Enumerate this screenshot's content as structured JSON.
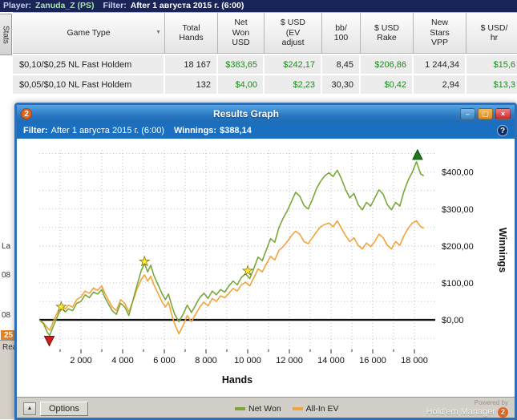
{
  "top_bar": {
    "player_label": "Player:",
    "player_name": "Zanuda_Z (PS)",
    "filter_label": "Filter:",
    "filter_value": "After 1 августа 2015 г. (6:00)"
  },
  "sidebar": {
    "stats_tab": "Stats",
    "fragment_la": "La",
    "fragment_08a": "08",
    "fragment_08b": "08",
    "fragment_25": "25",
    "fragment_read": "Read"
  },
  "table": {
    "sort_arrow": "▼",
    "columns": [
      "Game Type",
      "Total\nHands",
      "Net\nWon\nUSD",
      "$ USD\n(EV\nadjust",
      "bb/\n100",
      "$ USD\nRake",
      "New\nStars\nVPP",
      "$ USD/\nhr"
    ],
    "rows": [
      {
        "game_type": "$0,10/$0,25 NL Fast Holdem",
        "total_hands": "18 167",
        "net_won": "$383,65",
        "ev_adjust": "$242,17",
        "bb100": "8,45",
        "rake": "$206,86",
        "vpp": "1 244,34",
        "usd_hr": "$15,6"
      },
      {
        "game_type": "$0,05/$0,10 NL Fast Holdem",
        "total_hands": "132",
        "net_won": "$4,00",
        "ev_adjust": "$2,23",
        "bb100": "30,30",
        "rake": "$0,42",
        "vpp": "2,94",
        "usd_hr": "$13,3"
      }
    ]
  },
  "window": {
    "logo": "2",
    "title": "Results Graph",
    "min": "–",
    "max": "▢",
    "close": "×",
    "filter_label": "Filter:",
    "filter_value": "After 1 августа 2015 г. (6:00)",
    "winnings_label": "Winnings:",
    "winnings_value": "$388,14",
    "help": "?",
    "collapse": "▲",
    "options": "Options",
    "legend": [
      {
        "label": "Net Won",
        "color": "#78A83A"
      },
      {
        "label": "All-In EV",
        "color": "#F2A33C"
      }
    ],
    "powered_by": "Powered by",
    "brand": "Hold'em Manager",
    "badge": "2"
  },
  "chart_data": {
    "type": "line",
    "xlabel": "Hands",
    "ylabel": "Winnings",
    "xlim": [
      0,
      19000
    ],
    "ylim": [
      -80,
      460
    ],
    "grid": {
      "x_step": 1000,
      "y_step": 50,
      "y_start": -50,
      "y_end": 450
    },
    "x_ticks": [
      {
        "v": 2000,
        "label": "2 000"
      },
      {
        "v": 4000,
        "label": "4 000"
      },
      {
        "v": 6000,
        "label": "6 000"
      },
      {
        "v": 8000,
        "label": "8 000"
      },
      {
        "v": 10000,
        "label": "10 000"
      },
      {
        "v": 12000,
        "label": "12 000"
      },
      {
        "v": 14000,
        "label": "14 000"
      },
      {
        "v": 16000,
        "label": "16 000"
      },
      {
        "v": 18000,
        "label": "18 000"
      }
    ],
    "y_ticks": [
      {
        "v": 0,
        "label": "$0,00"
      },
      {
        "v": 100,
        "label": "$100,00"
      },
      {
        "v": 200,
        "label": "$200,00"
      },
      {
        "v": 300,
        "label": "$300,00"
      },
      {
        "v": 400,
        "label": "$400,00"
      }
    ],
    "series": [
      {
        "name": "All-In EV",
        "color": "#F2A33C",
        "points": [
          [
            0,
            0
          ],
          [
            200,
            -8
          ],
          [
            400,
            -22
          ],
          [
            500,
            -28
          ],
          [
            650,
            -8
          ],
          [
            800,
            12
          ],
          [
            950,
            28
          ],
          [
            1100,
            38
          ],
          [
            1250,
            30
          ],
          [
            1400,
            40
          ],
          [
            1600,
            35
          ],
          [
            1800,
            55
          ],
          [
            2000,
            62
          ],
          [
            2200,
            78
          ],
          [
            2400,
            72
          ],
          [
            2600,
            86
          ],
          [
            2800,
            80
          ],
          [
            3000,
            92
          ],
          [
            3150,
            72
          ],
          [
            3300,
            55
          ],
          [
            3500,
            35
          ],
          [
            3700,
            25
          ],
          [
            3900,
            55
          ],
          [
            4100,
            45
          ],
          [
            4300,
            22
          ],
          [
            4500,
            52
          ],
          [
            4700,
            85
          ],
          [
            4900,
            110
          ],
          [
            5050,
            122
          ],
          [
            5200,
            105
          ],
          [
            5350,
            118
          ],
          [
            5500,
            95
          ],
          [
            5700,
            72
          ],
          [
            5900,
            48
          ],
          [
            6050,
            35
          ],
          [
            6200,
            48
          ],
          [
            6350,
            15
          ],
          [
            6500,
            -12
          ],
          [
            6700,
            -38
          ],
          [
            6900,
            -15
          ],
          [
            7100,
            12
          ],
          [
            7300,
            -5
          ],
          [
            7500,
            15
          ],
          [
            7700,
            35
          ],
          [
            7900,
            48
          ],
          [
            8100,
            38
          ],
          [
            8300,
            58
          ],
          [
            8500,
            50
          ],
          [
            8700,
            65
          ],
          [
            8900,
            60
          ],
          [
            9100,
            72
          ],
          [
            9300,
            85
          ],
          [
            9500,
            78
          ],
          [
            9700,
            95
          ],
          [
            9900,
            102
          ],
          [
            10100,
            92
          ],
          [
            10300,
            115
          ],
          [
            10500,
            138
          ],
          [
            10700,
            130
          ],
          [
            10900,
            152
          ],
          [
            11100,
            172
          ],
          [
            11300,
            162
          ],
          [
            11500,
            188
          ],
          [
            11700,
            198
          ],
          [
            11900,
            212
          ],
          [
            12100,
            228
          ],
          [
            12300,
            240
          ],
          [
            12500,
            232
          ],
          [
            12700,
            212
          ],
          [
            12900,
            206
          ],
          [
            13100,
            222
          ],
          [
            13300,
            238
          ],
          [
            13500,
            252
          ],
          [
            13700,
            258
          ],
          [
            13900,
            262
          ],
          [
            14100,
            252
          ],
          [
            14300,
            268
          ],
          [
            14500,
            248
          ],
          [
            14700,
            228
          ],
          [
            14900,
            212
          ],
          [
            15100,
            222
          ],
          [
            15300,
            202
          ],
          [
            15500,
            192
          ],
          [
            15700,
            208
          ],
          [
            15900,
            198
          ],
          [
            16100,
            212
          ],
          [
            16300,
            232
          ],
          [
            16500,
            222
          ],
          [
            16700,
            202
          ],
          [
            16900,
            192
          ],
          [
            17100,
            212
          ],
          [
            17300,
            202
          ],
          [
            17500,
            228
          ],
          [
            17700,
            248
          ],
          [
            17900,
            262
          ],
          [
            18100,
            268
          ],
          [
            18300,
            252
          ],
          [
            18450,
            248
          ]
        ]
      },
      {
        "name": "Net Won",
        "color": "#78A83A",
        "points": [
          [
            0,
            0
          ],
          [
            200,
            -10
          ],
          [
            400,
            -35
          ],
          [
            500,
            -42
          ],
          [
            650,
            -20
          ],
          [
            800,
            0
          ],
          [
            950,
            20
          ],
          [
            1100,
            32
          ],
          [
            1250,
            22
          ],
          [
            1400,
            30
          ],
          [
            1600,
            25
          ],
          [
            1800,
            45
          ],
          [
            2000,
            50
          ],
          [
            2200,
            68
          ],
          [
            2400,
            60
          ],
          [
            2600,
            75
          ],
          [
            2800,
            70
          ],
          [
            3000,
            82
          ],
          [
            3150,
            60
          ],
          [
            3300,
            45
          ],
          [
            3500,
            25
          ],
          [
            3700,
            15
          ],
          [
            3900,
            45
          ],
          [
            4100,
            35
          ],
          [
            4300,
            12
          ],
          [
            4500,
            55
          ],
          [
            4700,
            95
          ],
          [
            4900,
            135
          ],
          [
            5050,
            152
          ],
          [
            5200,
            130
          ],
          [
            5350,
            148
          ],
          [
            5500,
            120
          ],
          [
            5700,
            95
          ],
          [
            5900,
            70
          ],
          [
            6050,
            55
          ],
          [
            6200,
            70
          ],
          [
            6350,
            40
          ],
          [
            6500,
            15
          ],
          [
            6700,
            -5
          ],
          [
            6900,
            15
          ],
          [
            7100,
            40
          ],
          [
            7300,
            20
          ],
          [
            7500,
            40
          ],
          [
            7700,
            60
          ],
          [
            7900,
            72
          ],
          [
            8100,
            58
          ],
          [
            8300,
            78
          ],
          [
            8500,
            68
          ],
          [
            8700,
            82
          ],
          [
            8900,
            75
          ],
          [
            9100,
            92
          ],
          [
            9300,
            105
          ],
          [
            9500,
            95
          ],
          [
            9700,
            115
          ],
          [
            9900,
            125
          ],
          [
            10100,
            112
          ],
          [
            10300,
            140
          ],
          [
            10500,
            170
          ],
          [
            10700,
            160
          ],
          [
            10900,
            190
          ],
          [
            11100,
            220
          ],
          [
            11300,
            210
          ],
          [
            11500,
            250
          ],
          [
            11700,
            275
          ],
          [
            11900,
            295
          ],
          [
            12100,
            320
          ],
          [
            12300,
            345
          ],
          [
            12500,
            335
          ],
          [
            12700,
            310
          ],
          [
            12900,
            300
          ],
          [
            13100,
            325
          ],
          [
            13300,
            355
          ],
          [
            13500,
            375
          ],
          [
            13700,
            390
          ],
          [
            13900,
            398
          ],
          [
            14100,
            388
          ],
          [
            14300,
            405
          ],
          [
            14500,
            382
          ],
          [
            14700,
            352
          ],
          [
            14900,
            330
          ],
          [
            15100,
            342
          ],
          [
            15300,
            312
          ],
          [
            15500,
            298
          ],
          [
            15700,
            318
          ],
          [
            15900,
            308
          ],
          [
            16100,
            330
          ],
          [
            16300,
            352
          ],
          [
            16500,
            340
          ],
          [
            16700,
            312
          ],
          [
            16900,
            298
          ],
          [
            17100,
            318
          ],
          [
            17300,
            308
          ],
          [
            17500,
            348
          ],
          [
            17700,
            378
          ],
          [
            17900,
            400
          ],
          [
            18100,
            428
          ],
          [
            18300,
            395
          ],
          [
            18450,
            390
          ]
        ]
      }
    ],
    "markers": {
      "stars": [
        [
          1050,
          35
        ],
        [
          5050,
          158
        ],
        [
          10000,
          132
        ]
      ],
      "star_color": "#FFE93C",
      "high_triangle": [
        18150,
        445
      ],
      "high_color": "#1C7A1C",
      "low_triangle": [
        480,
        -55
      ],
      "low_color": "#CC2020"
    }
  }
}
